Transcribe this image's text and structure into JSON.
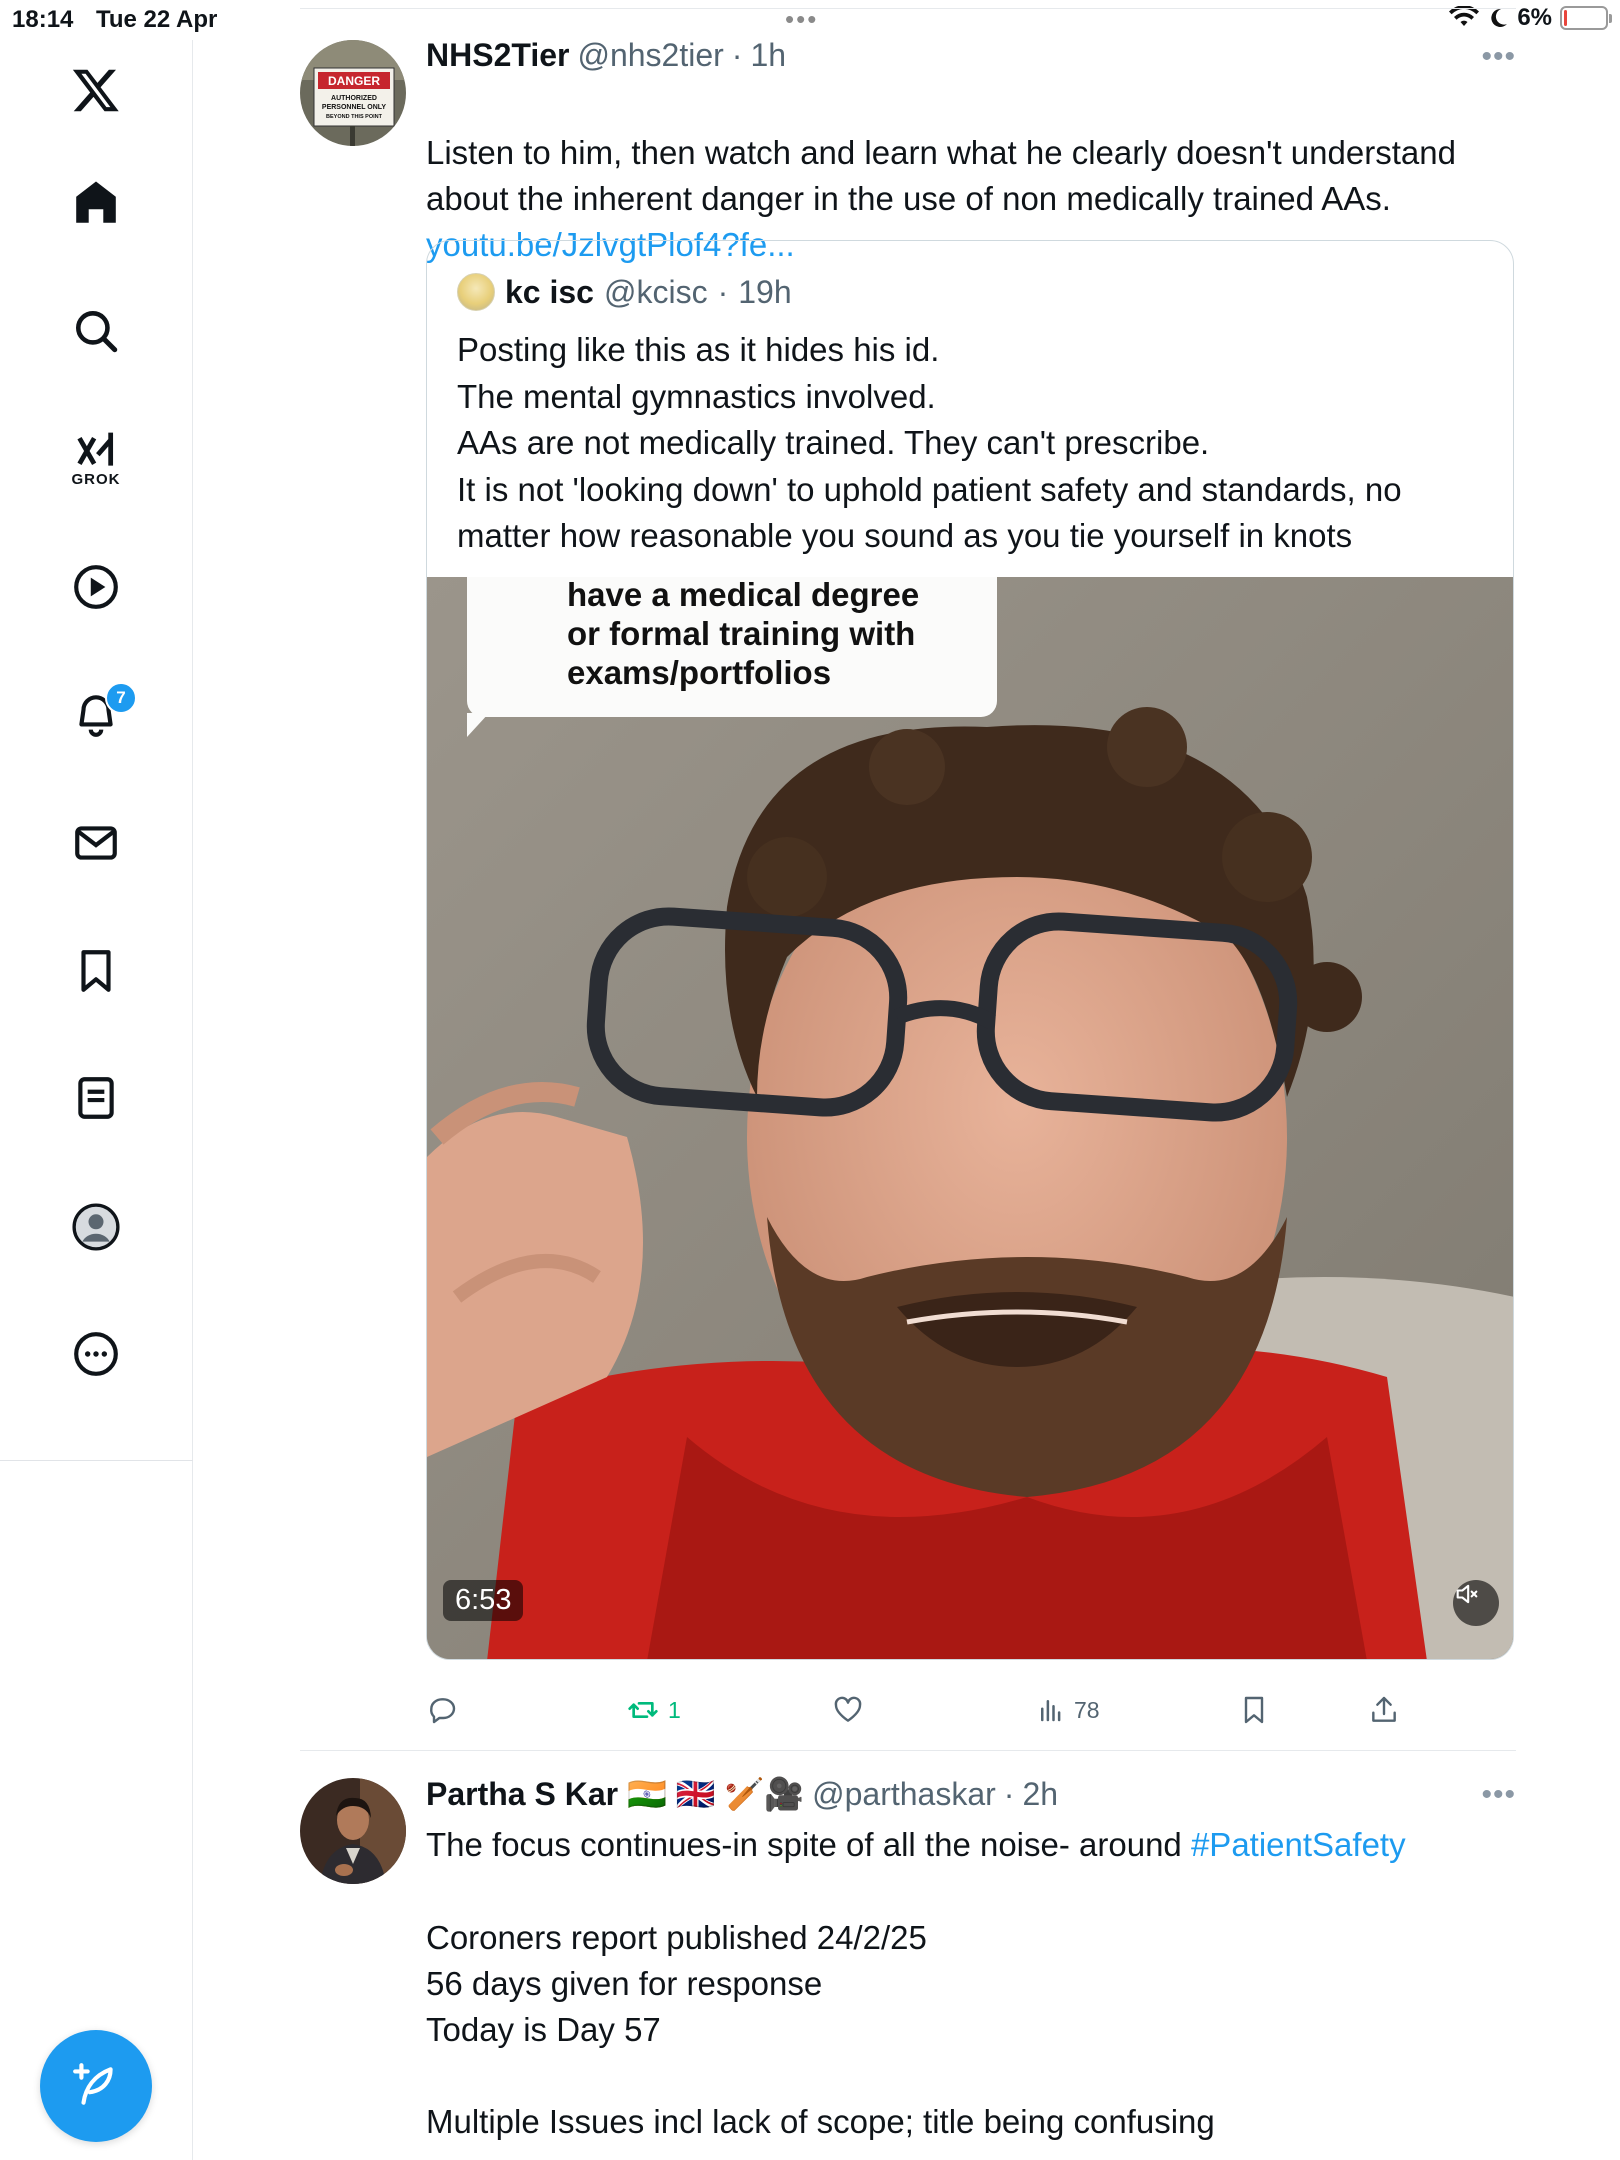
{
  "status_bar": {
    "time": "18:14",
    "date": "Tue 22 Apr",
    "battery_percent": "6%",
    "battery_level": 0.06,
    "battery_color": "#e8453c"
  },
  "sidebar": {
    "items": [
      {
        "name": "x-logo",
        "icon": "x-logo-icon"
      },
      {
        "name": "home",
        "icon": "home-icon"
      },
      {
        "name": "search",
        "icon": "search-icon"
      },
      {
        "name": "grok",
        "icon": "grok-icon",
        "label": "GROK"
      },
      {
        "name": "video",
        "icon": "play-icon"
      },
      {
        "name": "notifications",
        "icon": "bell-icon",
        "badge": "7"
      },
      {
        "name": "messages",
        "icon": "mail-icon"
      },
      {
        "name": "bookmarks",
        "icon": "bookmark-icon"
      },
      {
        "name": "lists",
        "icon": "list-icon"
      },
      {
        "name": "profile",
        "icon": "profile-icon"
      },
      {
        "name": "more",
        "icon": "more-icon"
      }
    ],
    "compose_icon": "compose-feather-icon"
  },
  "tweets": [
    {
      "name": "NHS2Tier",
      "handle": "@nhs2tier",
      "time": "1h",
      "text": "Listen to him, then watch and learn what he clearly doesn't understand\nabout the inherent danger in the use of non medically trained AAs.",
      "link": "youtu.be/JzlvgtPlof4?fe...",
      "avatar_sign": {
        "line1": "DANGER",
        "line2": "AUTHORIZED",
        "line3": "PERSONNEL ONLY",
        "line4": "BEYOND THIS POINT"
      },
      "quote": {
        "name": "kc isc",
        "handle": "@kcisc",
        "time": "19h",
        "text": "Posting like this as it hides his id.\nThe mental gymnastics involved.\nAAs are not medically trained. They can't prescribe.\nIt is not 'looking down' to  uphold patient safety and standards, no\nmatter how reasonable you sound as you tie yourself in knots",
        "video": {
          "caption": "have a medical degree\nor formal training with\nexams/portfolios",
          "duration": "6:53",
          "mute_icon": "speaker-muted-icon"
        }
      },
      "actions": {
        "reply": {
          "icon": "reply-icon",
          "count": ""
        },
        "retweet": {
          "icon": "retweet-icon",
          "count": "1",
          "color": "#00ba7c"
        },
        "like": {
          "icon": "heart-icon",
          "count": ""
        },
        "views": {
          "icon": "views-icon",
          "count": "78"
        },
        "bookmark": {
          "icon": "bookmark-icon"
        },
        "share": {
          "icon": "share-icon"
        }
      }
    },
    {
      "name": "Partha S Kar 🇮🇳 🇬🇧 🏏🎥",
      "handle": "@parthaskar",
      "time": "2h",
      "text_before_tag": "The focus continues-in spite of all the noise- around ",
      "hashtag": "#PatientSafety",
      "text_after": "Coroners report published 24/2/25\n56 days given for response\nToday is Day 57\n\nMultiple Issues incl lack of scope; title being confusing"
    }
  ],
  "colors": {
    "accent": "#1d9bf0",
    "text": "#0f1419",
    "secondary": "#536471",
    "retweet": "#00ba7c"
  }
}
